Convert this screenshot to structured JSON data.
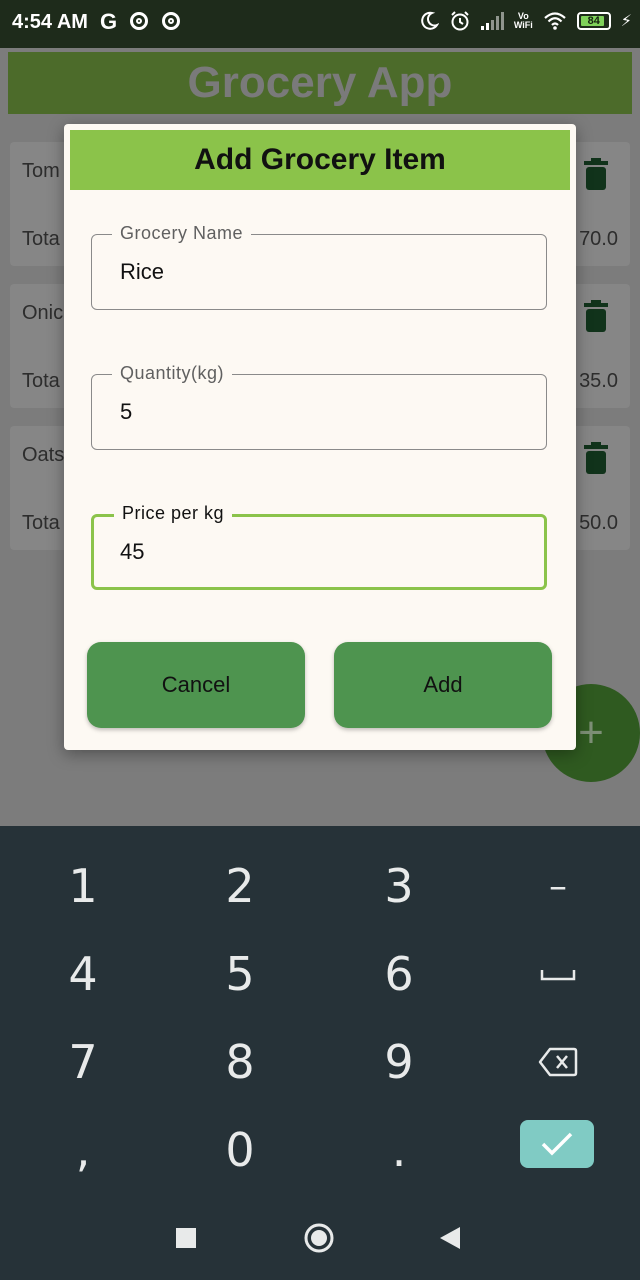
{
  "status_bar": {
    "time": "4:54 AM",
    "carrier_icon": "G",
    "vowifi_line1": "Vo",
    "vowifi_line2": "WiFi",
    "battery": "84"
  },
  "app": {
    "title": "Grocery App",
    "items": [
      {
        "name": "Tom",
        "total": "Tota",
        "price": "70.0"
      },
      {
        "name": "Onic",
        "total": "Tota",
        "price": "35.0"
      },
      {
        "name": "Oats",
        "total": "Tota",
        "price": "50.0"
      }
    ],
    "fab_label": "+"
  },
  "dialog": {
    "title": "Add Grocery Item",
    "fields": {
      "grocery_name": {
        "label": "Grocery Name",
        "value": "Rice"
      },
      "quantity": {
        "label": "Quantity(kg)",
        "value": "5"
      },
      "price": {
        "label": "Price per kg",
        "value": "45"
      }
    },
    "cancel_label": "Cancel",
    "add_label": "Add"
  },
  "keyboard": {
    "rows": [
      [
        "1",
        "2",
        "3",
        "–"
      ],
      [
        "4",
        "5",
        "6",
        "␣"
      ],
      [
        "7",
        "8",
        "9",
        "⌫"
      ],
      [
        ",",
        "0",
        ".",
        "✓"
      ]
    ]
  },
  "colors": {
    "accent": "#8bc34a",
    "button": "#4e944f",
    "keyboard_bg": "#263238",
    "enter_key": "#80cbc4"
  },
  "icons": [
    "moon-icon",
    "alarm-icon",
    "signal-icon",
    "wifi-icon",
    "battery-icon",
    "charging-icon",
    "trash-icon",
    "add-icon",
    "backspace-icon",
    "check-icon",
    "home-icon",
    "recents-icon",
    "back-icon"
  ]
}
